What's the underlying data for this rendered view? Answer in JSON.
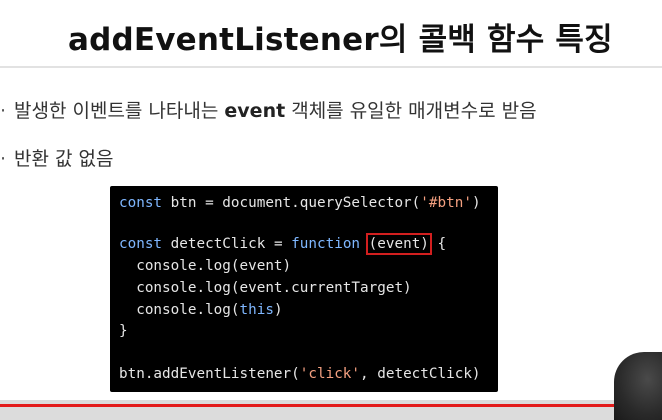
{
  "slide": {
    "title": "addEventListener의 콜백 함수 특징",
    "bullets": [
      {
        "before": "발생한 이벤트를 나타내는 ",
        "bold": "event",
        "after": " 객체를 유일한 매개변수로 받음"
      },
      {
        "before": "반환 값 없음",
        "bold": "",
        "after": ""
      }
    ],
    "bullet_glyph": "·"
  },
  "code": {
    "line1": {
      "kw": "const",
      "rest": " btn = document.querySelector(",
      "str": "'#btn'",
      "end": ")"
    },
    "line2": {
      "kw": "const",
      "mid": " detectClick = ",
      "kw2": "function",
      "sp": " ",
      "param": "(event)",
      "end": " {"
    },
    "line3": "  console.log(event)",
    "line4": "  console.log(event.currentTarget)",
    "line5": {
      "pre": "  console.log(",
      "kw": "this",
      "end": ")"
    },
    "line6": "}",
    "line7": {
      "pre": "btn.addEventListener(",
      "str": "'click'",
      "end": ", detectClick)"
    }
  },
  "video": {
    "progress": 1.0
  },
  "colors": {
    "highlight": "#d21f1f",
    "progress": "#e31b1b",
    "code_bg": "#000000"
  }
}
